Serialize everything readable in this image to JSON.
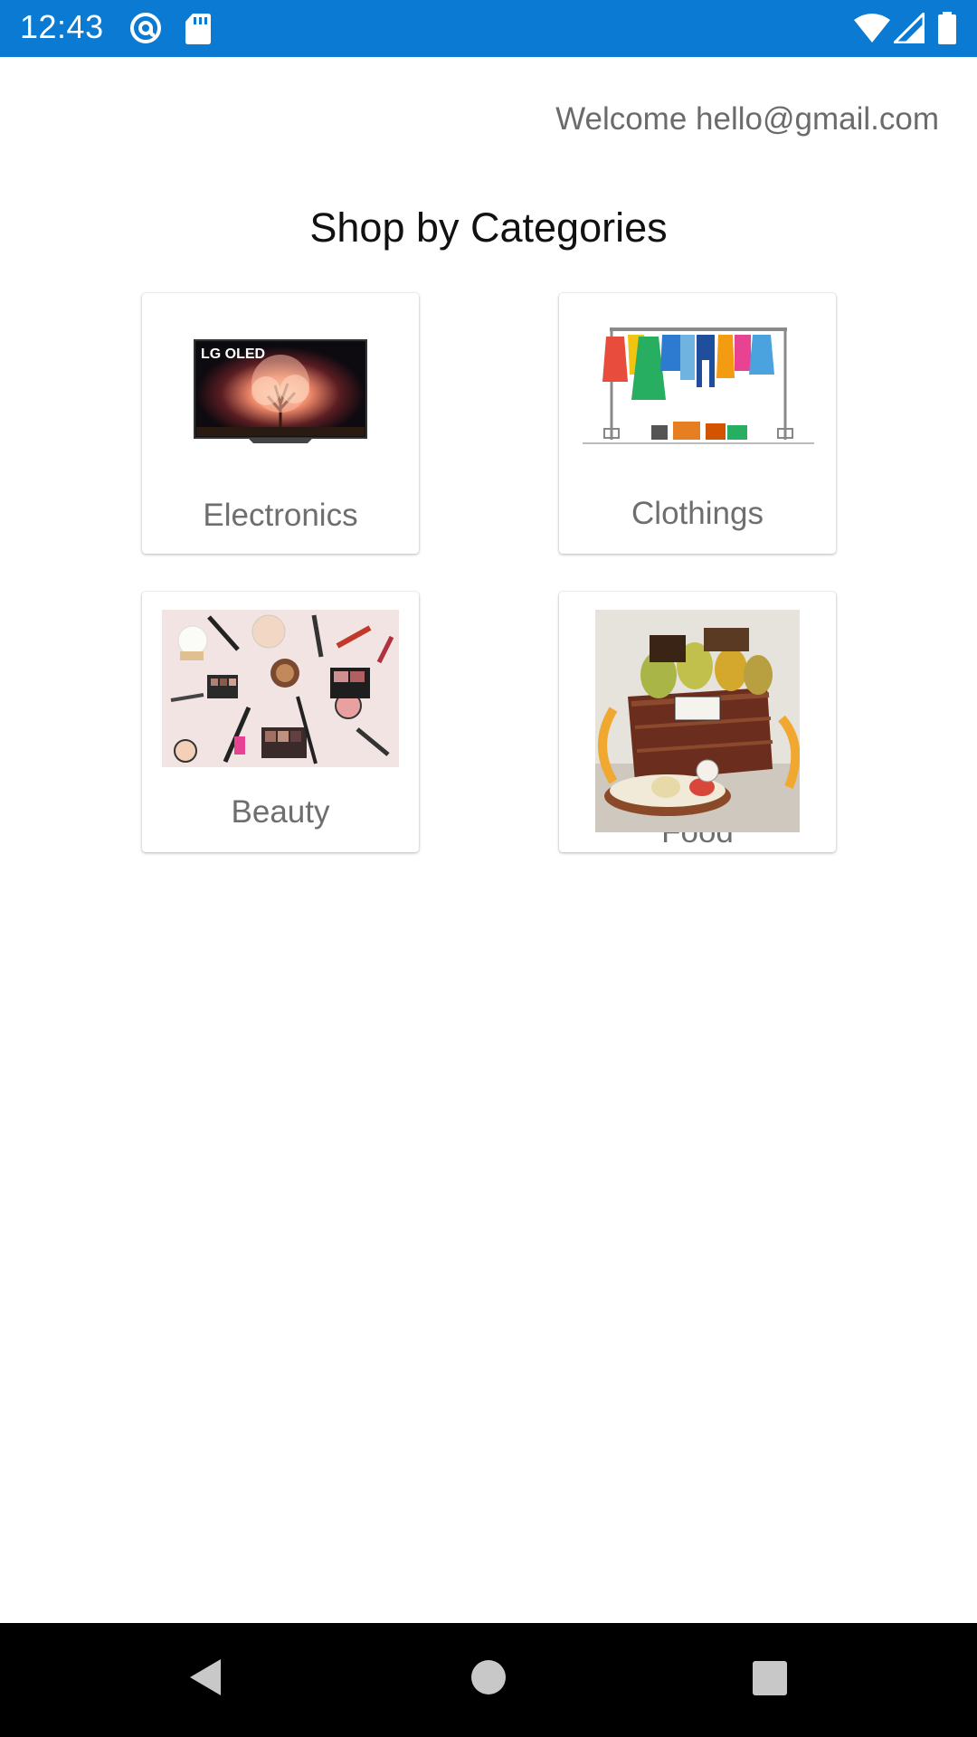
{
  "status_bar": {
    "time": "12:43",
    "icons": [
      "at-sign-icon",
      "sd-card-icon",
      "wifi-icon",
      "signal-icon",
      "battery-icon"
    ],
    "color": "#0a7ad2"
  },
  "header": {
    "welcome_text": "Welcome hello@gmail.com",
    "title": "Shop by Categories"
  },
  "categories": [
    {
      "label": "Electronics",
      "image": "lg-oled-tv-image"
    },
    {
      "label": "Clothings",
      "image": "clothing-rack-image"
    },
    {
      "label": "Beauty",
      "image": "makeup-products-image"
    },
    {
      "label": "Food",
      "image": "food-gift-basket-image"
    }
  ],
  "nav_bar": {
    "buttons": [
      "back-icon",
      "home-icon",
      "recents-icon"
    ]
  }
}
